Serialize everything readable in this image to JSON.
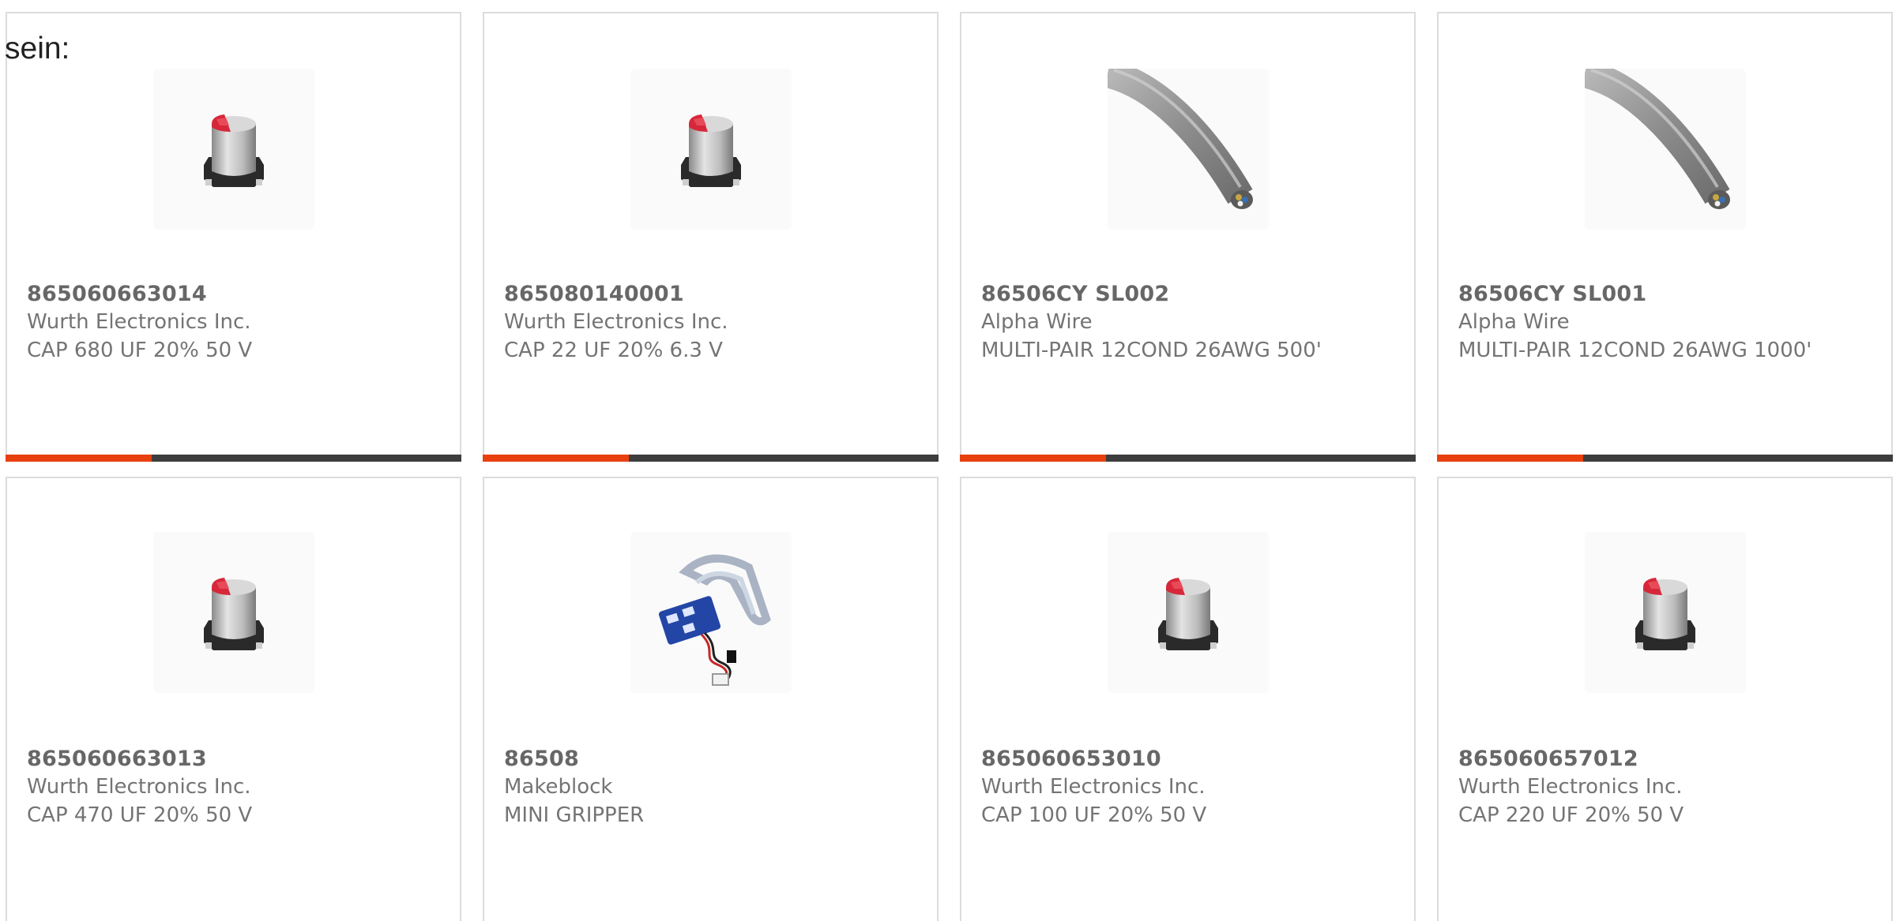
{
  "intro_text": "sein:",
  "colors": {
    "accent": "#e8400f",
    "bar": "#3d3d3d",
    "border": "#dcdcdc",
    "text": "#676767"
  },
  "products": [
    {
      "part_number": "865060663014",
      "manufacturer": "Wurth Electronics Inc.",
      "description": "CAP 680 UF 20% 50 V",
      "image": "capacitor-image",
      "bar_fill": 0.32
    },
    {
      "part_number": "865080140001",
      "manufacturer": "Wurth Electronics Inc.",
      "description": "CAP 22 UF 20% 6.3 V",
      "image": "capacitor-image",
      "bar_fill": 0.32
    },
    {
      "part_number": "86506CY SL002",
      "manufacturer": "Alpha Wire",
      "description": "MULTI-PAIR 12COND 26AWG 500'",
      "image": "cable-image",
      "bar_fill": 0.32
    },
    {
      "part_number": "86506CY SL001",
      "manufacturer": "Alpha Wire",
      "description": "MULTI-PAIR 12COND 26AWG 1000'",
      "image": "cable-image",
      "bar_fill": 0.32
    },
    {
      "part_number": "865060663013",
      "manufacturer": "Wurth Electronics Inc.",
      "description": "CAP 470 UF 20% 50 V",
      "image": "capacitor-image"
    },
    {
      "part_number": "86508",
      "manufacturer": "Makeblock",
      "description": "MINI GRIPPER",
      "image": "gripper-image"
    },
    {
      "part_number": "865060653010",
      "manufacturer": "Wurth Electronics Inc.",
      "description": "CAP 100 UF 20% 50 V",
      "image": "capacitor-image"
    },
    {
      "part_number": "865060657012",
      "manufacturer": "Wurth Electronics Inc.",
      "description": "CAP 220 UF 20% 50 V",
      "image": "capacitor-image"
    }
  ]
}
